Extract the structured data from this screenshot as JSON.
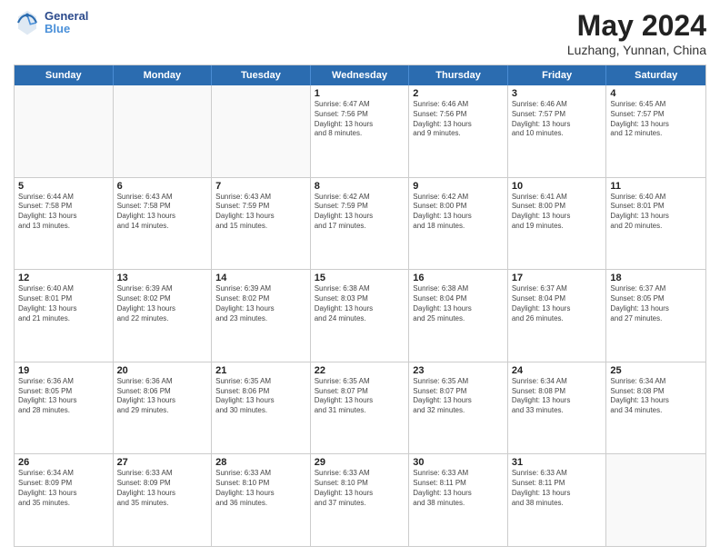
{
  "header": {
    "logo_line1": "General",
    "logo_line2": "Blue",
    "title": "May 2024",
    "subtitle": "Luzhang, Yunnan, China"
  },
  "calendar": {
    "days_of_week": [
      "Sunday",
      "Monday",
      "Tuesday",
      "Wednesday",
      "Thursday",
      "Friday",
      "Saturday"
    ],
    "weeks": [
      [
        {
          "day": "",
          "info": "",
          "empty": true
        },
        {
          "day": "",
          "info": "",
          "empty": true
        },
        {
          "day": "",
          "info": "",
          "empty": true
        },
        {
          "day": "1",
          "info": "Sunrise: 6:47 AM\nSunset: 7:56 PM\nDaylight: 13 hours\nand 8 minutes.",
          "empty": false
        },
        {
          "day": "2",
          "info": "Sunrise: 6:46 AM\nSunset: 7:56 PM\nDaylight: 13 hours\nand 9 minutes.",
          "empty": false
        },
        {
          "day": "3",
          "info": "Sunrise: 6:46 AM\nSunset: 7:57 PM\nDaylight: 13 hours\nand 10 minutes.",
          "empty": false
        },
        {
          "day": "4",
          "info": "Sunrise: 6:45 AM\nSunset: 7:57 PM\nDaylight: 13 hours\nand 12 minutes.",
          "empty": false
        }
      ],
      [
        {
          "day": "5",
          "info": "Sunrise: 6:44 AM\nSunset: 7:58 PM\nDaylight: 13 hours\nand 13 minutes.",
          "empty": false
        },
        {
          "day": "6",
          "info": "Sunrise: 6:43 AM\nSunset: 7:58 PM\nDaylight: 13 hours\nand 14 minutes.",
          "empty": false
        },
        {
          "day": "7",
          "info": "Sunrise: 6:43 AM\nSunset: 7:59 PM\nDaylight: 13 hours\nand 15 minutes.",
          "empty": false
        },
        {
          "day": "8",
          "info": "Sunrise: 6:42 AM\nSunset: 7:59 PM\nDaylight: 13 hours\nand 17 minutes.",
          "empty": false
        },
        {
          "day": "9",
          "info": "Sunrise: 6:42 AM\nSunset: 8:00 PM\nDaylight: 13 hours\nand 18 minutes.",
          "empty": false
        },
        {
          "day": "10",
          "info": "Sunrise: 6:41 AM\nSunset: 8:00 PM\nDaylight: 13 hours\nand 19 minutes.",
          "empty": false
        },
        {
          "day": "11",
          "info": "Sunrise: 6:40 AM\nSunset: 8:01 PM\nDaylight: 13 hours\nand 20 minutes.",
          "empty": false
        }
      ],
      [
        {
          "day": "12",
          "info": "Sunrise: 6:40 AM\nSunset: 8:01 PM\nDaylight: 13 hours\nand 21 minutes.",
          "empty": false
        },
        {
          "day": "13",
          "info": "Sunrise: 6:39 AM\nSunset: 8:02 PM\nDaylight: 13 hours\nand 22 minutes.",
          "empty": false
        },
        {
          "day": "14",
          "info": "Sunrise: 6:39 AM\nSunset: 8:02 PM\nDaylight: 13 hours\nand 23 minutes.",
          "empty": false
        },
        {
          "day": "15",
          "info": "Sunrise: 6:38 AM\nSunset: 8:03 PM\nDaylight: 13 hours\nand 24 minutes.",
          "empty": false
        },
        {
          "day": "16",
          "info": "Sunrise: 6:38 AM\nSunset: 8:04 PM\nDaylight: 13 hours\nand 25 minutes.",
          "empty": false
        },
        {
          "day": "17",
          "info": "Sunrise: 6:37 AM\nSunset: 8:04 PM\nDaylight: 13 hours\nand 26 minutes.",
          "empty": false
        },
        {
          "day": "18",
          "info": "Sunrise: 6:37 AM\nSunset: 8:05 PM\nDaylight: 13 hours\nand 27 minutes.",
          "empty": false
        }
      ],
      [
        {
          "day": "19",
          "info": "Sunrise: 6:36 AM\nSunset: 8:05 PM\nDaylight: 13 hours\nand 28 minutes.",
          "empty": false
        },
        {
          "day": "20",
          "info": "Sunrise: 6:36 AM\nSunset: 8:06 PM\nDaylight: 13 hours\nand 29 minutes.",
          "empty": false
        },
        {
          "day": "21",
          "info": "Sunrise: 6:35 AM\nSunset: 8:06 PM\nDaylight: 13 hours\nand 30 minutes.",
          "empty": false
        },
        {
          "day": "22",
          "info": "Sunrise: 6:35 AM\nSunset: 8:07 PM\nDaylight: 13 hours\nand 31 minutes.",
          "empty": false
        },
        {
          "day": "23",
          "info": "Sunrise: 6:35 AM\nSunset: 8:07 PM\nDaylight: 13 hours\nand 32 minutes.",
          "empty": false
        },
        {
          "day": "24",
          "info": "Sunrise: 6:34 AM\nSunset: 8:08 PM\nDaylight: 13 hours\nand 33 minutes.",
          "empty": false
        },
        {
          "day": "25",
          "info": "Sunrise: 6:34 AM\nSunset: 8:08 PM\nDaylight: 13 hours\nand 34 minutes.",
          "empty": false
        }
      ],
      [
        {
          "day": "26",
          "info": "Sunrise: 6:34 AM\nSunset: 8:09 PM\nDaylight: 13 hours\nand 35 minutes.",
          "empty": false
        },
        {
          "day": "27",
          "info": "Sunrise: 6:33 AM\nSunset: 8:09 PM\nDaylight: 13 hours\nand 35 minutes.",
          "empty": false
        },
        {
          "day": "28",
          "info": "Sunrise: 6:33 AM\nSunset: 8:10 PM\nDaylight: 13 hours\nand 36 minutes.",
          "empty": false
        },
        {
          "day": "29",
          "info": "Sunrise: 6:33 AM\nSunset: 8:10 PM\nDaylight: 13 hours\nand 37 minutes.",
          "empty": false
        },
        {
          "day": "30",
          "info": "Sunrise: 6:33 AM\nSunset: 8:11 PM\nDaylight: 13 hours\nand 38 minutes.",
          "empty": false
        },
        {
          "day": "31",
          "info": "Sunrise: 6:33 AM\nSunset: 8:11 PM\nDaylight: 13 hours\nand 38 minutes.",
          "empty": false
        },
        {
          "day": "",
          "info": "",
          "empty": true
        }
      ]
    ]
  }
}
